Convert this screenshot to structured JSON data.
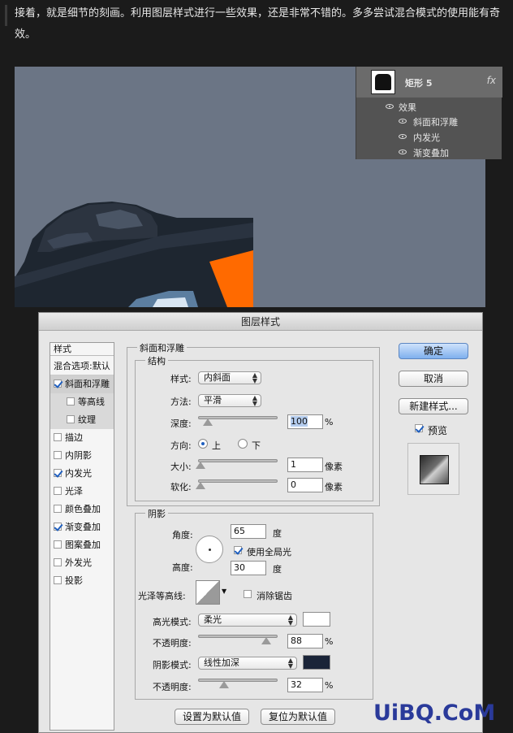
{
  "article": {
    "text": "接着，就是细节的刻画。利用图层样式进行一些效果，还是非常不错的。多多尝试混合模式的使用能有奇效。"
  },
  "layers_panel": {
    "layer_name": "矩形 5",
    "fx_label": "fx",
    "effects_label": "效果",
    "effects": [
      "斜面和浮雕",
      "内发光",
      "渐变叠加"
    ]
  },
  "dialog": {
    "title": "图层样式",
    "style_list": {
      "header": "样式",
      "blend_options": "混合选项:默认",
      "items": [
        {
          "label": "斜面和浮雕",
          "checked": true,
          "sub": false,
          "selected": true
        },
        {
          "label": "等高线",
          "checked": false,
          "sub": true,
          "selected": false
        },
        {
          "label": "纹理",
          "checked": false,
          "sub": true,
          "selected": false
        },
        {
          "label": "描边",
          "checked": false,
          "sub": false,
          "selected": false
        },
        {
          "label": "内阴影",
          "checked": false,
          "sub": false,
          "selected": false
        },
        {
          "label": "内发光",
          "checked": true,
          "sub": false,
          "selected": false
        },
        {
          "label": "光泽",
          "checked": false,
          "sub": false,
          "selected": false
        },
        {
          "label": "颜色叠加",
          "checked": false,
          "sub": false,
          "selected": false
        },
        {
          "label": "渐变叠加",
          "checked": true,
          "sub": false,
          "selected": false
        },
        {
          "label": "图案叠加",
          "checked": false,
          "sub": false,
          "selected": false
        },
        {
          "label": "外发光",
          "checked": false,
          "sub": false,
          "selected": false
        },
        {
          "label": "投影",
          "checked": false,
          "sub": false,
          "selected": false
        }
      ]
    },
    "bevel": {
      "group_title": "斜面和浮雕",
      "structure_title": "结构",
      "style_label": "样式:",
      "style_value": "内斜面",
      "technique_label": "方法:",
      "technique_value": "平滑",
      "depth_label": "深度:",
      "depth_value": "100",
      "depth_unit": "%",
      "depth_level": 0.1,
      "direction_label": "方向:",
      "direction_up": "上",
      "direction_down": "下",
      "size_label": "大小:",
      "size_value": "1",
      "size_unit": "像素",
      "size_level": 0.0,
      "soften_label": "软化:",
      "soften_value": "0",
      "soften_unit": "像素",
      "soften_level": 0.0
    },
    "shading": {
      "group_title": "阴影",
      "angle_label": "角度:",
      "angle_value": "65",
      "angle_unit": "度",
      "global_light_label": "使用全局光",
      "altitude_label": "高度:",
      "altitude_value": "30",
      "altitude_unit": "度",
      "gloss_contour_label": "光泽等高线:",
      "antialias_label": "消除锯齿",
      "highlight_mode_label": "高光模式:",
      "highlight_mode_value": "柔光",
      "highlight_color": "#ffffff",
      "highlight_opacity_label": "不透明度:",
      "highlight_opacity_value": "88",
      "highlight_opacity_unit": "%",
      "highlight_opacity_level": 0.88,
      "shadow_mode_label": "阴影模式:",
      "shadow_mode_value": "线性加深",
      "shadow_color": "#1a2438",
      "shadow_opacity_label": "不透明度:",
      "shadow_opacity_value": "32",
      "shadow_opacity_unit": "%",
      "shadow_opacity_level": 0.32
    },
    "buttons": {
      "make_default": "设置为默认值",
      "reset_default": "复位为默认值",
      "ok": "确定",
      "cancel": "取消",
      "new_style": "新建样式...",
      "preview": "预览"
    }
  },
  "watermark": "UiBQ.CoM"
}
